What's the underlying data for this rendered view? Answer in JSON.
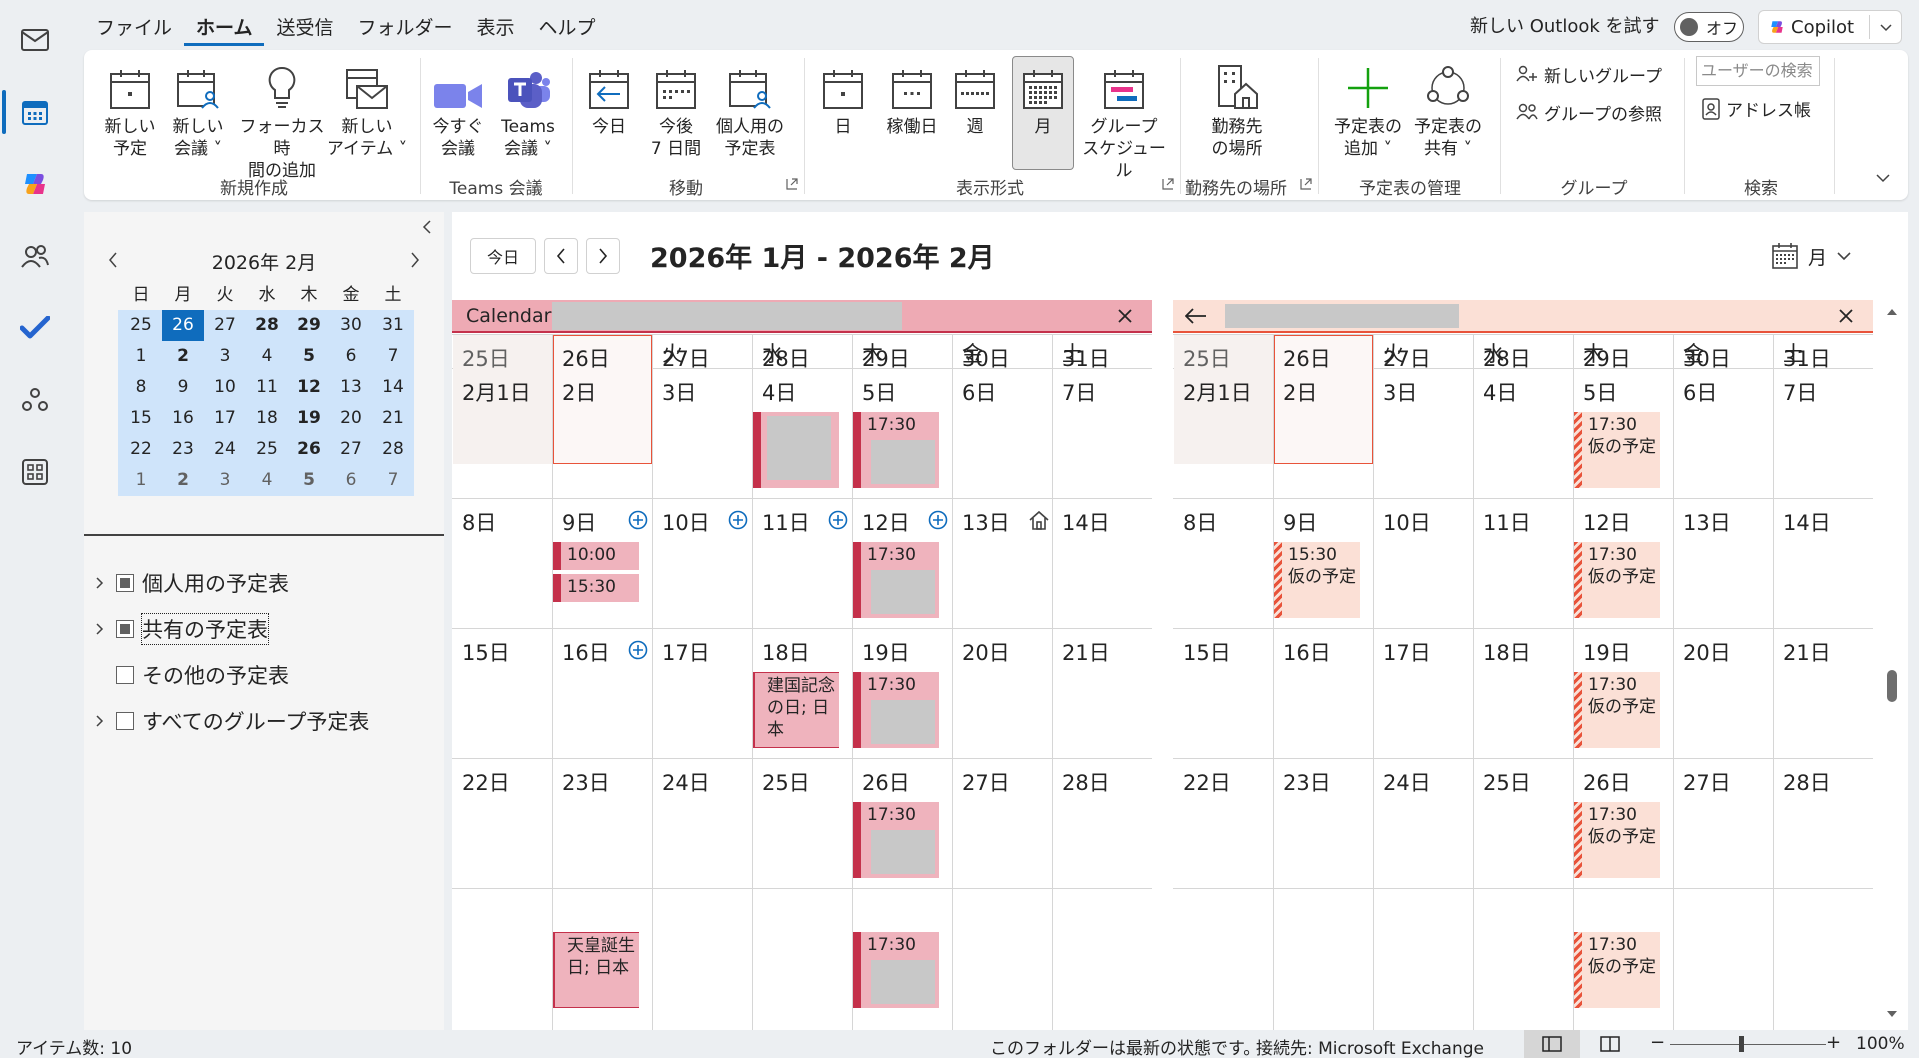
{
  "menu": {
    "items": [
      "ファイル",
      "ホーム",
      "送受信",
      "フォルダー",
      "表示",
      "ヘルプ"
    ],
    "active": 1
  },
  "top_right": {
    "try_new": "新しい Outlook を試す",
    "toggle": "オフ",
    "copilot": "Copilot"
  },
  "ribbon": {
    "new_appointment": "新しい\n予定",
    "new_meeting": "新しい\n会議 ˅",
    "focus_time": "フォーカス時\n間の追加",
    "new_items": "新しい\nアイテム ˅",
    "group_new": "新規作成",
    "meet_now": "今すぐ\n会議",
    "teams_meeting": "Teams\n会議 ˅",
    "group_teams": "Teams 会議",
    "today": "今日",
    "next7": "今後\n7 日間",
    "personal_cal": "個人用の\n予定表",
    "group_goto": "移動",
    "day": "日",
    "workweek": "稼働日",
    "week": "週",
    "month": "月",
    "schedule": "グループ\nスケジュール",
    "group_arrange": "表示形式",
    "work_location": "勤務先\nの場所",
    "group_location": "勤務先の場所",
    "add_calendar": "予定表の\n追加 ˅",
    "share_calendar": "予定表の\n共有 ˅",
    "group_manage": "予定表の管理",
    "new_group": "新しいグループ",
    "browse_groups": "グループの参照",
    "group_groups": "グループ",
    "search_people_placeholder": "ユーザーの検索",
    "address_book": "アドレス帳",
    "group_find": "検索"
  },
  "mini_calendar": {
    "title": "2026年 2月",
    "weekdays": [
      "日",
      "月",
      "火",
      "水",
      "木",
      "金",
      "土"
    ],
    "rows": [
      [
        "25",
        "26",
        "27",
        "28",
        "29",
        "30",
        "31"
      ],
      [
        "1",
        "2",
        "3",
        "4",
        "5",
        "6",
        "7"
      ],
      [
        "8",
        "9",
        "10",
        "11",
        "12",
        "13",
        "14"
      ],
      [
        "15",
        "16",
        "17",
        "18",
        "19",
        "20",
        "21"
      ],
      [
        "22",
        "23",
        "24",
        "25",
        "26",
        "27",
        "28"
      ],
      [
        "1",
        "2",
        "3",
        "4",
        "5",
        "6",
        "7"
      ]
    ],
    "today": "26"
  },
  "folders": [
    {
      "label": "個人用の予定表",
      "expand": true,
      "check": "partial"
    },
    {
      "label": "共有の予定表",
      "expand": true,
      "check": "partial",
      "focused": true
    },
    {
      "label": "その他の予定表",
      "expand": false,
      "check": "empty"
    },
    {
      "label": "すべてのグループ予定表",
      "expand": true,
      "check": "empty"
    }
  ],
  "toolbar": {
    "today": "今日",
    "range_title": "2026年 1月 - 2026年 2月",
    "view": "月"
  },
  "calendar_left": {
    "name": "Calendar"
  },
  "weekdays": [
    "日",
    "月",
    "火",
    "水",
    "木",
    "金",
    "土"
  ],
  "weeks": [
    [
      "25日",
      "26日",
      "27日",
      "28日",
      "29日",
      "30日",
      "31日"
    ],
    [
      "2月1日",
      "2日",
      "3日",
      "4日",
      "5日",
      "6日",
      "7日"
    ],
    [
      "8日",
      "9日",
      "10日",
      "11日",
      "12日",
      "13日",
      "14日"
    ],
    [
      "15日",
      "16日",
      "17日",
      "18日",
      "19日",
      "20日",
      "21日"
    ],
    [
      "22日",
      "23日",
      "24日",
      "25日",
      "26日",
      "27日",
      "28日"
    ]
  ],
  "events_left": [
    {
      "week": 0,
      "day": 3,
      "type": "busy",
      "text": ""
    },
    {
      "week": 0,
      "day": 4,
      "type": "busy",
      "text": "17:30"
    },
    {
      "week": 1,
      "day": 1,
      "type": "busy",
      "text": "10:00",
      "slot": 0
    },
    {
      "week": 1,
      "day": 1,
      "type": "busy",
      "text": "15:30",
      "slot": 1
    },
    {
      "week": 1,
      "day": 4,
      "type": "busy",
      "text": "17:30"
    },
    {
      "week": 2,
      "day": 3,
      "type": "holiday",
      "text": "建国記念の日; 日本"
    },
    {
      "week": 2,
      "day": 4,
      "type": "busy",
      "text": "17:30"
    },
    {
      "week": 3,
      "day": 4,
      "type": "busy",
      "text": "17:30"
    },
    {
      "week": 4,
      "day": 1,
      "type": "holiday",
      "text": "天皇誕生日; 日本"
    },
    {
      "week": 4,
      "day": 4,
      "type": "busy",
      "text": "17:30"
    }
  ],
  "events_right": [
    {
      "week": 0,
      "day": 4,
      "text": "17:30 仮の予定"
    },
    {
      "week": 1,
      "day": 1,
      "text": "15:30 仮の予定"
    },
    {
      "week": 1,
      "day": 4,
      "text": "17:30 仮の予定"
    },
    {
      "week": 2,
      "day": 4,
      "text": "17:30 仮の予定"
    },
    {
      "week": 3,
      "day": 4,
      "text": "17:30 仮の予定"
    },
    {
      "week": 4,
      "day": 4,
      "text": "17:30 仮の予定"
    }
  ],
  "status": {
    "items": "アイテム数: 10",
    "folder_state": "このフォルダーは最新の状態です。",
    "connection": "接続先: Microsoft Exchange",
    "zoom": "100%"
  }
}
